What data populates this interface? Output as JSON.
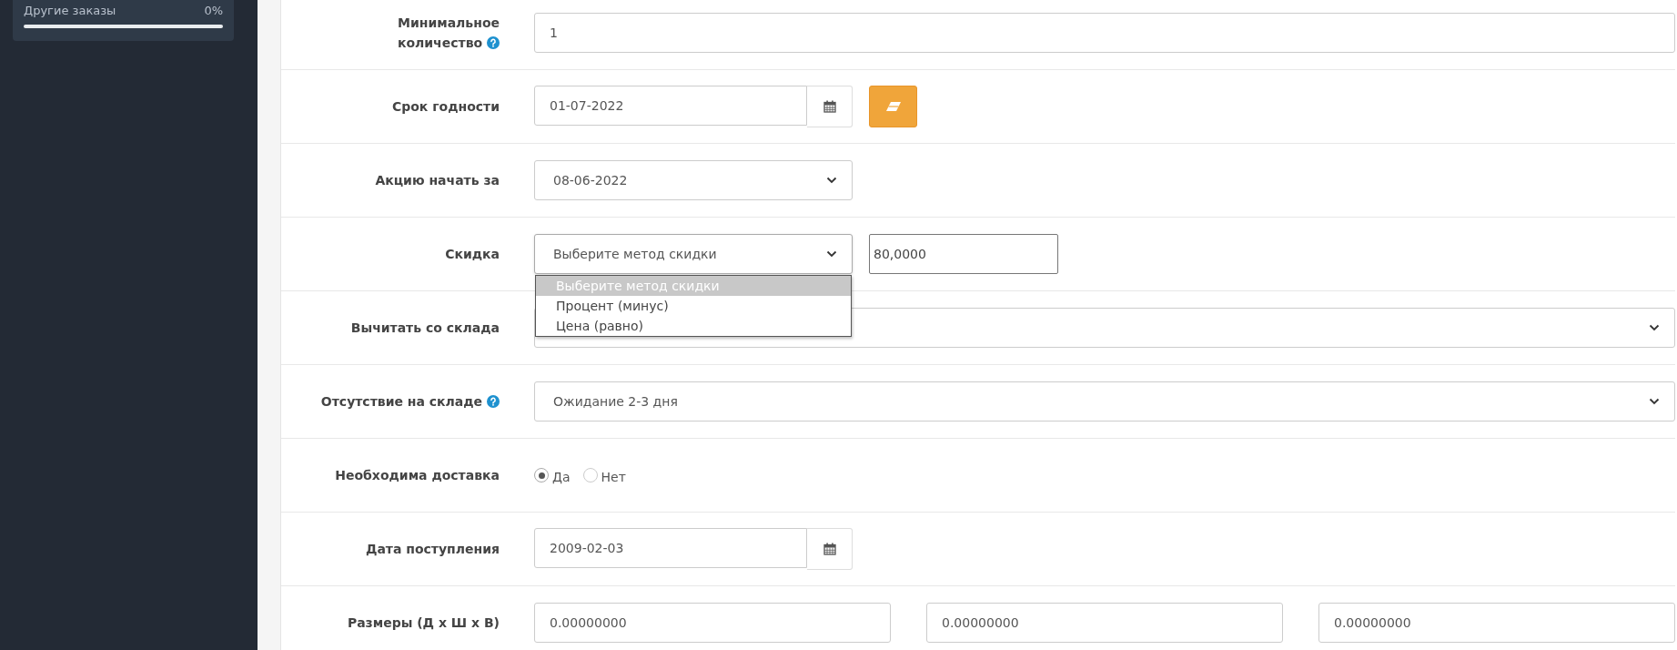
{
  "sidebar": {
    "progress": {
      "label": "Другие заказы",
      "reading": "0%"
    }
  },
  "fields": [
    {
      "kind": "text",
      "label": "Минимальное количество",
      "help": true,
      "value": "1"
    },
    {
      "kind": "date_clear",
      "label": "Срок годности",
      "help": false,
      "value": "01-07-2022"
    },
    {
      "kind": "select",
      "label": "Акцию начать за",
      "help": false,
      "value": "08-06-2022",
      "short": true
    },
    {
      "kind": "select_number",
      "label": "Скидка",
      "help": false,
      "value": "Выберите метод скидки",
      "number": "80,0000",
      "expanded": true,
      "options": [
        {
          "label": "Выберите метод скидки",
          "selected": true
        },
        {
          "label": "Процент (минус)",
          "selected": false
        },
        {
          "label": "Цена (равно)",
          "selected": false
        }
      ]
    },
    {
      "kind": "select",
      "label": "Вычитать со склада",
      "help": false,
      "short": false
    },
    {
      "kind": "select",
      "label": "Отсутствие на складе",
      "help": true,
      "value": "Ожидание 2-3 дня",
      "short": false
    },
    {
      "kind": "radio",
      "label": "Необходима доставка",
      "help": false,
      "options": [
        {
          "label": "Да",
          "selected": true
        },
        {
          "label": "Нет",
          "selected": false
        }
      ]
    },
    {
      "kind": "date",
      "label": "Дата поступления",
      "help": false,
      "value": "2009-02-03"
    },
    {
      "kind": "dimensions",
      "label": "Размеры (Д x Ш x В)",
      "help": false,
      "values": [
        "0.00000000",
        "0.00000000",
        "0.00000000"
      ]
    }
  ]
}
